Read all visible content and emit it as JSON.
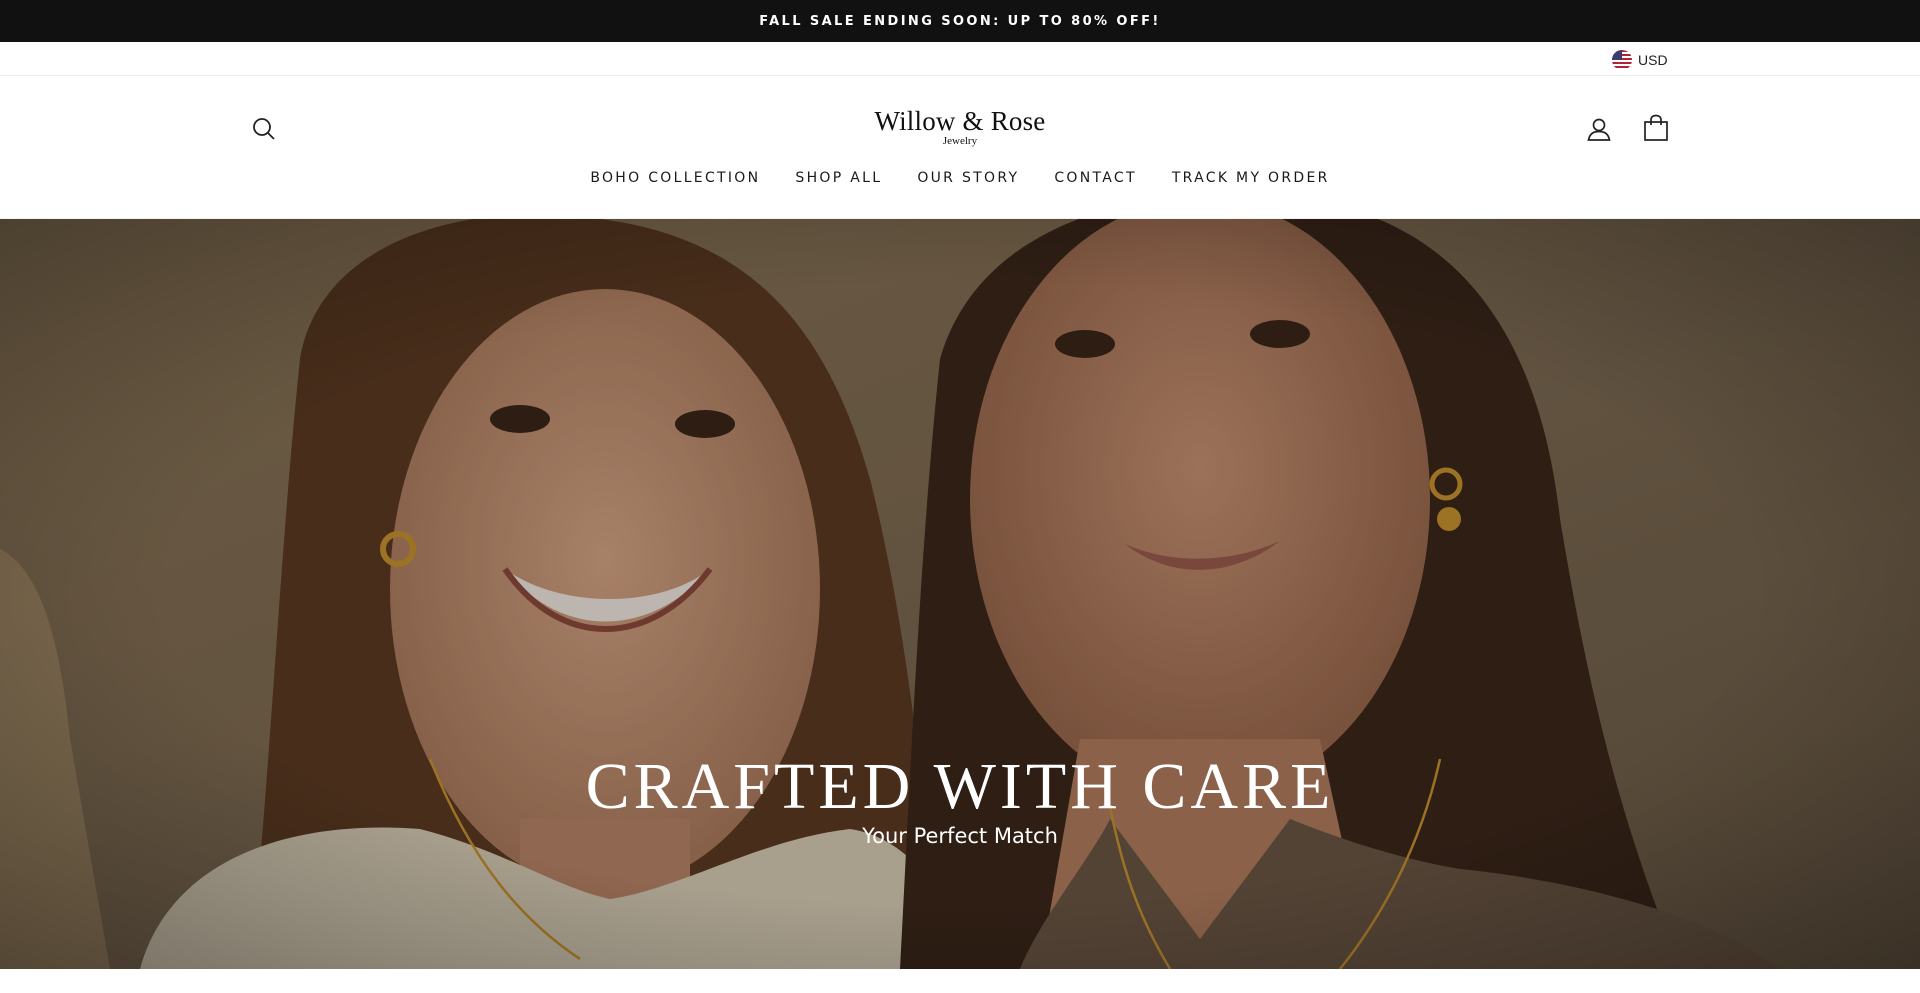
{
  "announcement": {
    "text": "FALL SALE ENDING SOON: UP TO 80% OFF!"
  },
  "currency": {
    "code": "USD",
    "flag_icon": "us-flag-icon"
  },
  "header": {
    "logo_name": "Willow & Rose",
    "logo_sub": "Jewelry",
    "icons": {
      "search": "search-icon",
      "account": "user-icon",
      "cart": "shopping-bag-icon"
    }
  },
  "nav": {
    "items": [
      {
        "label": "BOHO COLLECTION"
      },
      {
        "label": "SHOP ALL"
      },
      {
        "label": "OUR STORY"
      },
      {
        "label": "CONTACT"
      },
      {
        "label": "TRACK MY ORDER"
      }
    ]
  },
  "hero": {
    "heading": "CRAFTED WITH CARE",
    "subheading": "Your Perfect Match"
  },
  "colors": {
    "announcement_bg": "#111111",
    "hero_tone": "#7a6650",
    "text_dark": "#111111"
  }
}
